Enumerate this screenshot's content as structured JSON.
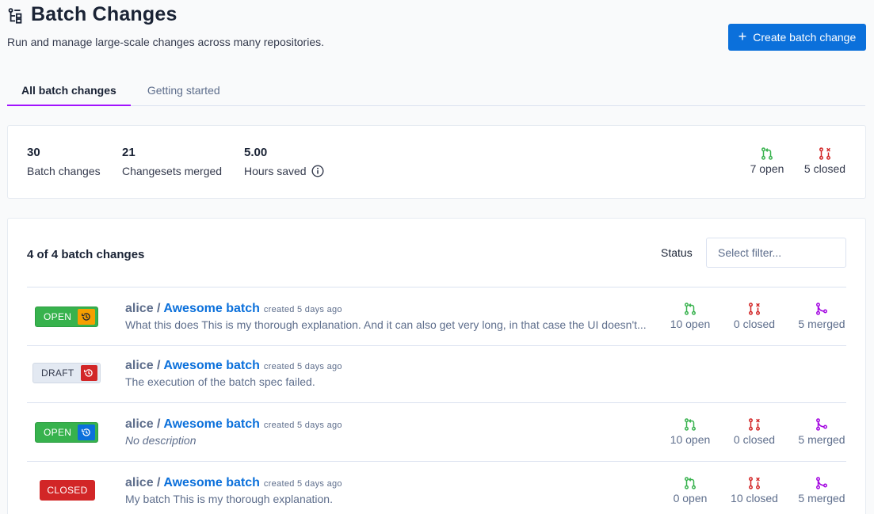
{
  "page": {
    "title": "Batch Changes",
    "subtitle": "Run and manage large-scale changes across many repositories.",
    "title_icon": "batch-changes-icon",
    "create_button": {
      "label": "Create batch change",
      "icon": "plus-icon"
    }
  },
  "tabs": [
    {
      "label": "All batch changes",
      "active": true
    },
    {
      "label": "Getting started",
      "active": false
    }
  ],
  "stats": {
    "batch_changes": {
      "value": "30",
      "label": "Batch changes"
    },
    "changesets_merged": {
      "value": "21",
      "label": "Changesets merged"
    },
    "hours_saved": {
      "value": "5.00",
      "label": "Hours saved",
      "icon": "info-icon"
    },
    "open": "7 open",
    "closed": "5 closed"
  },
  "list": {
    "count_label": "4 of 4 batch changes",
    "status_label": "Status",
    "filter_placeholder": "Select filter...",
    "rows": [
      {
        "state": "OPEN",
        "state_icon": "history-icon",
        "namespace": "alice",
        "separator": " / ",
        "name": "Awesome batch",
        "created": "created 5 days ago",
        "description": "What this does This is my thorough explanation. And it can also get very long, in that case the UI doesn't...",
        "open": "10 open",
        "closed": "0 closed",
        "merged": "5 merged"
      },
      {
        "state": "DRAFT",
        "state_icon": "history-icon",
        "namespace": "alice",
        "separator": " / ",
        "name": "Awesome batch",
        "created": "created 5 days ago",
        "description": "The execution of the batch spec failed."
      },
      {
        "state": "OPEN",
        "state_icon": "history-icon",
        "namespace": "alice",
        "separator": " / ",
        "name": "Awesome batch",
        "created": "created 5 days ago",
        "description": "No description",
        "open": "10 open",
        "closed": "0 closed",
        "merged": "5 merged"
      },
      {
        "state": "CLOSED",
        "namespace": "alice",
        "separator": " / ",
        "name": "Awesome batch",
        "created": "created 5 days ago",
        "description": "My batch This is my thorough explanation.",
        "open": "0 open",
        "closed": "10 closed",
        "merged": "5 merged"
      }
    ]
  },
  "colors": {
    "accent": "#0b70db",
    "open": "#37b24d",
    "closed": "#d22627",
    "merged": "#a305e1",
    "warning": "#f59f00",
    "tab_underline": "#a112ff"
  }
}
